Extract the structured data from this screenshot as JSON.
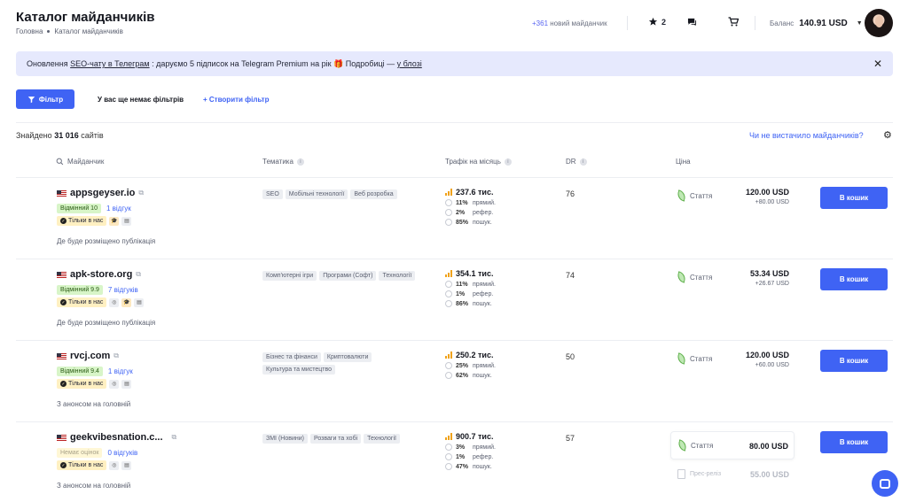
{
  "header": {
    "title": "Каталог майданчиків",
    "breadcrumb": [
      "Головна",
      "Каталог майданчиків"
    ],
    "new_sites_count": "+361",
    "new_sites_label": "новий майданчик",
    "favorites_count": "2",
    "balance_label": "Баланс",
    "balance_amount": "140.91 USD"
  },
  "banner": {
    "prefix": "Оновлення",
    "link1": "SEO-чату в Телеграм",
    "middle": ": даруємо 5 підписок на Telegram Premium на рік 🎁 Подробиці —",
    "link2": "у блозі"
  },
  "toolbar": {
    "filter_label": "Фільтр",
    "no_filters": "У вас ще немає фільтрів",
    "create_filter": "Створити фільтр"
  },
  "summary": {
    "found_prefix": "Знайдено",
    "found_count": "31 016",
    "found_suffix": "сайтів",
    "missing_link": "Чи не вистачило майданчиків?"
  },
  "columns": {
    "site": "Майданчик",
    "topic": "Тематика",
    "traffic": "Трафік на місяць",
    "dr": "DR",
    "price": "Ціна"
  },
  "traffic_labels": {
    "direct": "прямий.",
    "referral": "рефер.",
    "search": "пошук."
  },
  "cart_label": "В кошик",
  "article_label": "Стаття",
  "press_label": "Прес-реліз",
  "only_here": "Тільки в нас",
  "rows": [
    {
      "name": "appsgeyser.io",
      "rating": "Відмінний 10",
      "reviews": "1 відгук",
      "placement": "Де буде розміщено публікація",
      "tags": [
        "SEO",
        "Мобільні технології",
        "Веб розробка"
      ],
      "traffic": "237.6 тис.",
      "direct": "11%",
      "referral": "2%",
      "search": "85%",
      "dr": "76",
      "price": "120.00 USD",
      "price_sub": "+80.00 USD"
    },
    {
      "name": "apk-store.org",
      "rating": "Відмінний 9.9",
      "reviews": "7 відгуків",
      "placement": "Де буде розміщено публікація",
      "tags": [
        "Комп'ютерні ігри",
        "Програми (Софт)",
        "Технології"
      ],
      "traffic": "354.1 тис.",
      "direct": "11%",
      "referral": "1%",
      "search": "86%",
      "dr": "74",
      "price": "53.34 USD",
      "price_sub": "+26.67 USD"
    },
    {
      "name": "rvcj.com",
      "rating": "Відмінний 9.4",
      "reviews": "1 відгук",
      "placement": "З анонсом на головній",
      "tags": [
        "Бізнес та фінанси",
        "Криптовалюти",
        "Культура та мистецтво"
      ],
      "traffic": "250.2 тис.",
      "direct": "25%",
      "referral": "",
      "search": "62%",
      "dr": "50",
      "price": "120.00 USD",
      "price_sub": "+60.00 USD"
    },
    {
      "name": "geekvibesnation.c...",
      "rating": "Немає оцінок",
      "reviews": "0 відгуків",
      "placement": "З анонсом на головній",
      "tags": [
        "ЗМІ (Новини)",
        "Розваги та хобі",
        "Технології"
      ],
      "traffic": "900.7 тис.",
      "direct": "3%",
      "referral": "1%",
      "search": "47%",
      "dr": "57",
      "price": "80.00 USD",
      "press_price": "55.00 USD"
    }
  ]
}
